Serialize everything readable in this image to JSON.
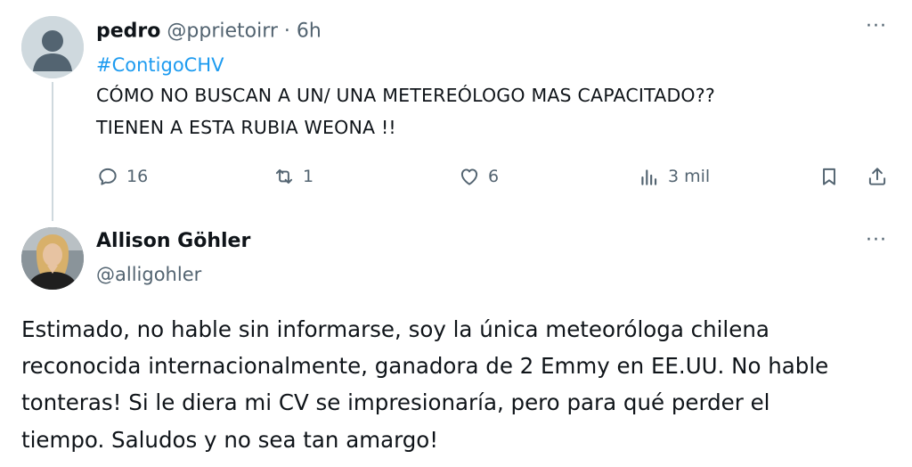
{
  "tweet1": {
    "display_name": "pedro",
    "handle": "@pprietoirr",
    "separator": "·",
    "time": "6h",
    "hashtag": "#ContigoCHV",
    "lines": [
      "CÓMO NO BUSCAN A UN/ UNA  METEREÓLOGO MAS CAPACITADO??",
      "TIENEN A ESTA RUBIA  WEONA !!"
    ],
    "more": "···",
    "actions": {
      "replies": "16",
      "reposts": "1",
      "likes": "6",
      "views": "3 mil"
    }
  },
  "tweet2": {
    "display_name": "Allison Göhler",
    "handle": "@alligohler",
    "more": "···",
    "lines": [
      "Estimado, no hable sin informarse, soy la única meteoróloga chilena",
      "reconocida internacionalmente, ganadora de 2 Emmy en EE.UU. No hable",
      "tonteras! Si le diera mi CV se impresionaría, pero para qué perder el",
      "tiempo. Saludos y no sea tan amargo!"
    ]
  },
  "icons": {
    "reply": "reply-icon",
    "repost": "repost-icon",
    "like": "heart-icon",
    "views": "views-icon",
    "bookmark": "bookmark-icon",
    "share": "share-icon",
    "more": "more-icon"
  },
  "colors": {
    "text": "#0f1419",
    "muted": "#536471",
    "link": "#1d9bf0"
  }
}
